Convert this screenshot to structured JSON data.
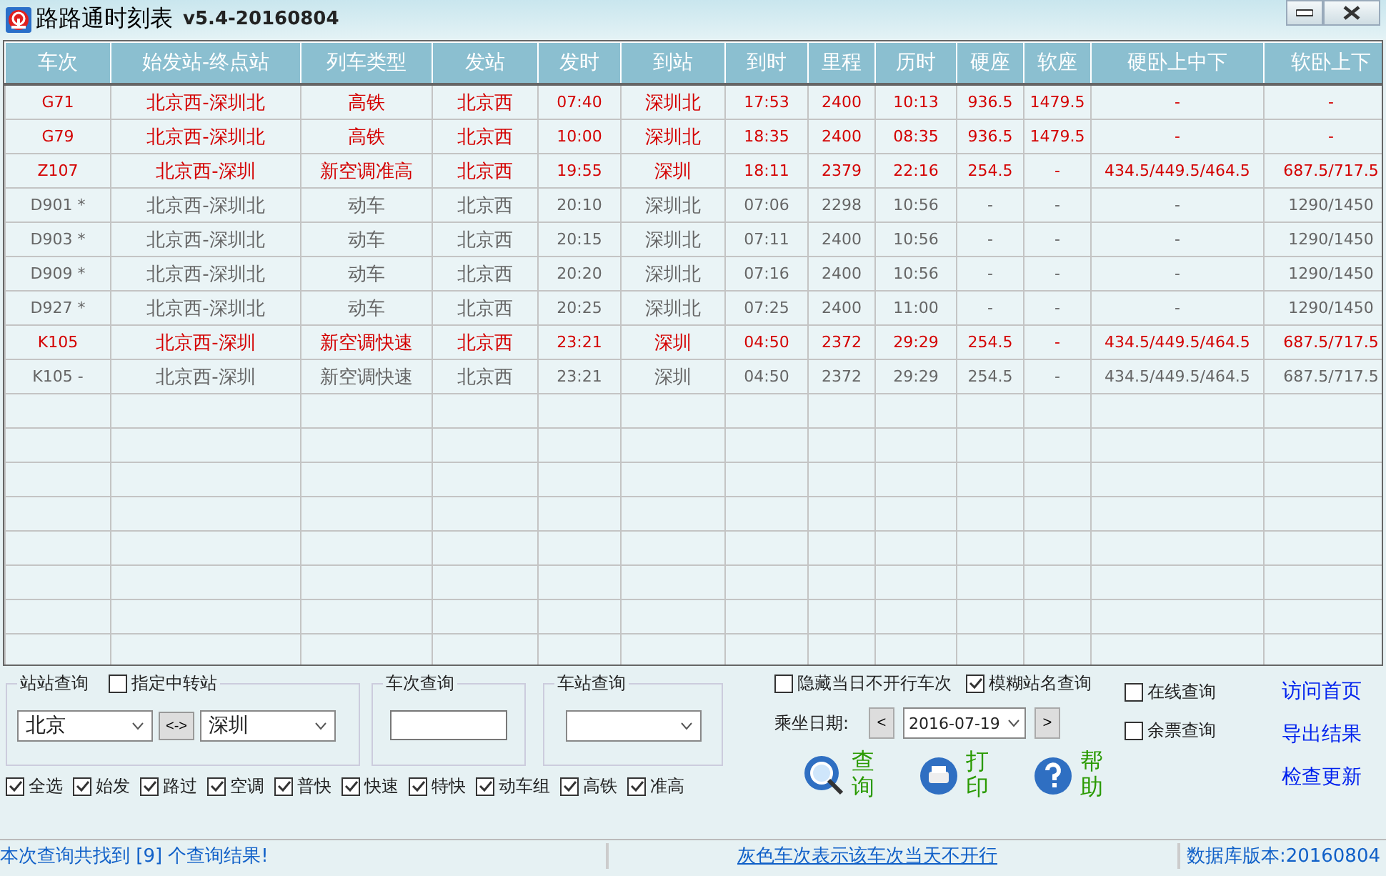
{
  "window": {
    "title": "路路通时刻表",
    "version": "v5.4-20160804"
  },
  "table": {
    "columns": [
      "车次",
      "始发站-终点站",
      "列车类型",
      "发站",
      "发时",
      "到站",
      "到时",
      "里程",
      "历时",
      "硬座",
      "软座",
      "硬卧上中下",
      "软卧上下"
    ],
    "rows": [
      {
        "operating": true,
        "cells": [
          "G71",
          "北京西-深圳北",
          "高铁",
          "北京西",
          "07:40",
          "深圳北",
          "17:53",
          "2400",
          "10:13",
          "936.5",
          "1479.5",
          "-",
          "-"
        ]
      },
      {
        "operating": true,
        "cells": [
          "G79",
          "北京西-深圳北",
          "高铁",
          "北京西",
          "10:00",
          "深圳北",
          "18:35",
          "2400",
          "08:35",
          "936.5",
          "1479.5",
          "-",
          "-"
        ]
      },
      {
        "operating": true,
        "cells": [
          "Z107",
          "北京西-深圳",
          "新空调准高",
          "北京西",
          "19:55",
          "深圳",
          "18:11",
          "2379",
          "22:16",
          "254.5",
          "-",
          "434.5/449.5/464.5",
          "687.5/717.5"
        ]
      },
      {
        "operating": false,
        "cells": [
          "D901 *",
          "北京西-深圳北",
          "动车",
          "北京西",
          "20:10",
          "深圳北",
          "07:06",
          "2298",
          "10:56",
          "-",
          "-",
          "-",
          "1290/1450"
        ]
      },
      {
        "operating": false,
        "cells": [
          "D903 *",
          "北京西-深圳北",
          "动车",
          "北京西",
          "20:15",
          "深圳北",
          "07:11",
          "2400",
          "10:56",
          "-",
          "-",
          "-",
          "1290/1450"
        ]
      },
      {
        "operating": false,
        "cells": [
          "D909 *",
          "北京西-深圳北",
          "动车",
          "北京西",
          "20:20",
          "深圳北",
          "07:16",
          "2400",
          "10:56",
          "-",
          "-",
          "-",
          "1290/1450"
        ]
      },
      {
        "operating": false,
        "cells": [
          "D927 *",
          "北京西-深圳北",
          "动车",
          "北京西",
          "20:25",
          "深圳北",
          "07:25",
          "2400",
          "11:00",
          "-",
          "-",
          "-",
          "1290/1450"
        ]
      },
      {
        "operating": true,
        "cells": [
          "K105",
          "北京西-深圳",
          "新空调快速",
          "北京西",
          "23:21",
          "深圳",
          "04:50",
          "2372",
          "29:29",
          "254.5",
          "-",
          "434.5/449.5/464.5",
          "687.5/717.5"
        ]
      },
      {
        "operating": false,
        "cells": [
          "K105 -",
          "北京西-深圳",
          "新空调快速",
          "北京西",
          "23:21",
          "深圳",
          "04:50",
          "2372",
          "29:29",
          "254.5",
          "-",
          "434.5/449.5/464.5",
          "687.5/717.5"
        ]
      }
    ]
  },
  "station_query": {
    "title": "站站查询",
    "transfer": {
      "label": "指定中转站",
      "checked": false
    },
    "from": "北京",
    "swap": "<->",
    "to": "深圳"
  },
  "train_query": {
    "title": "车次查询"
  },
  "station_lookup": {
    "title": "车站查询"
  },
  "filters": [
    {
      "label": "全选",
      "checked": true
    },
    {
      "label": "始发",
      "checked": true
    },
    {
      "label": "路过",
      "checked": true
    },
    {
      "label": "空调",
      "checked": true
    },
    {
      "label": "普快",
      "checked": true
    },
    {
      "label": "快速",
      "checked": true
    },
    {
      "label": "特快",
      "checked": true
    },
    {
      "label": "动车组",
      "checked": true
    },
    {
      "label": "高铁",
      "checked": true
    },
    {
      "label": "准高",
      "checked": true
    }
  ],
  "options": [
    {
      "label": "隐藏当日不开行车次",
      "checked": false
    },
    {
      "label": "模糊站名查询",
      "checked": true
    }
  ],
  "date": {
    "label": "乘坐日期:",
    "prev": "<",
    "value": "2016-07-19",
    "next": ">"
  },
  "online": [
    {
      "label": "在线查询",
      "checked": false
    },
    {
      "label": "余票查询",
      "checked": false
    }
  ],
  "actions": [
    {
      "kind": "search",
      "label": "查询"
    },
    {
      "kind": "print",
      "label": "打印"
    },
    {
      "kind": "help",
      "label": "帮助"
    }
  ],
  "links": [
    "访问首页",
    "导出结果",
    "检查更新"
  ],
  "status_bar": {
    "result": "本次查询共找到 [9] 个查询结果!",
    "hint": "灰色车次表示该车次当天不开行",
    "db_version": "数据库版本:20160804"
  }
}
